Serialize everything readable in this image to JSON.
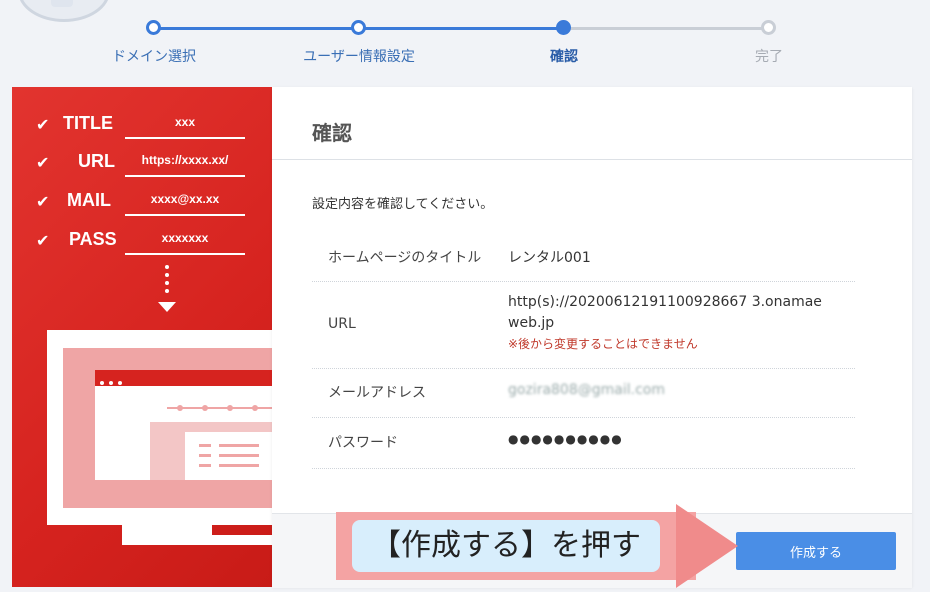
{
  "stepper": {
    "steps": [
      {
        "label": "ドメイン選択",
        "state": "done"
      },
      {
        "label": "ユーザー情報設定",
        "state": "done"
      },
      {
        "label": "確認",
        "state": "current"
      },
      {
        "label": "完了",
        "state": "todo"
      }
    ],
    "colors": {
      "active": "#3a7ad9",
      "inactive": "#c9ced6"
    }
  },
  "illustration": {
    "fields": [
      {
        "key": "TITLE",
        "value": "xxx"
      },
      {
        "key": "URL",
        "value": "https://xxxx.xx/"
      },
      {
        "key": "MAIL",
        "value": "xxxx@xx.xx"
      },
      {
        "key": "PASS",
        "value": "xxxxxxx"
      }
    ],
    "check_icon": "check-icon",
    "accent": "#d6231f"
  },
  "card": {
    "title": "確認",
    "intro": "設定内容を確認してください。",
    "rows": [
      {
        "label": "ホームページのタイトル",
        "value": "レンタル001"
      },
      {
        "label": "URL",
        "value_line1": "http(s)://20200612191100928667 3.onamae",
        "value_line2": "web.jp",
        "note": "※後から変更することはできません"
      },
      {
        "label": "メールアドレス",
        "value": "gozira808@gmail.com"
      },
      {
        "label": "パスワード",
        "value": "●●●●●●●●●●"
      }
    ]
  },
  "footer": {
    "create_label": "作成する",
    "button_color": "#4a8ee6"
  },
  "annotation": {
    "text": "【作成する】を押す"
  }
}
